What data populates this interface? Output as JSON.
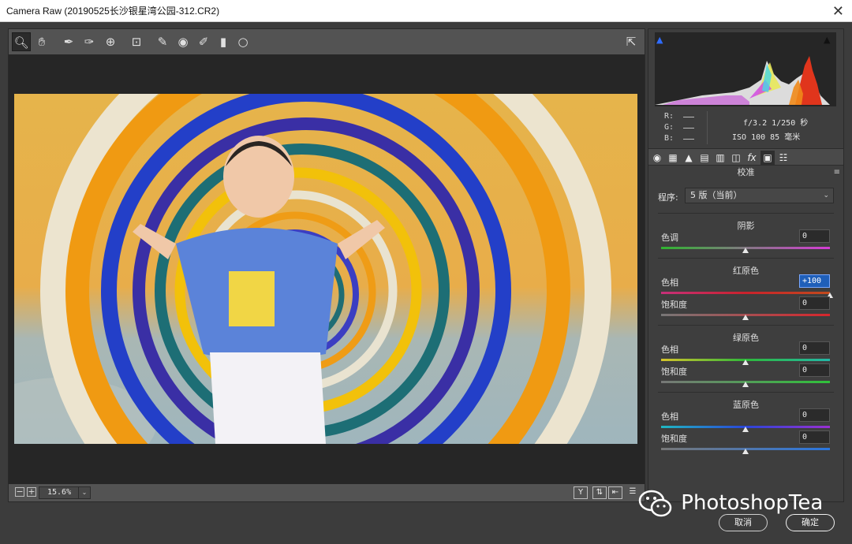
{
  "window": {
    "title": "Camera Raw (20190525长沙银星湾公园-312.CR2)"
  },
  "toolbar": {
    "tools": [
      {
        "icon": "zoom-icon",
        "glyph": "🔍︎"
      },
      {
        "icon": "hand-icon",
        "glyph": "✋︎"
      },
      {
        "icon": "white-balance-icon",
        "glyph": "✒"
      },
      {
        "icon": "color-sampler-icon",
        "glyph": "✑"
      },
      {
        "icon": "target-adjust-icon",
        "glyph": "⊕"
      },
      {
        "icon": "crop-icon",
        "glyph": "⊡"
      },
      {
        "icon": "spot-removal-icon",
        "glyph": "✎"
      },
      {
        "icon": "red-eye-icon",
        "glyph": "◉"
      },
      {
        "icon": "adjustment-brush-icon",
        "glyph": "✐"
      },
      {
        "icon": "graduated-filter-icon",
        "glyph": "▮"
      },
      {
        "icon": "radial-filter-icon",
        "glyph": "○"
      }
    ],
    "open_preferences_glyph": "⇱"
  },
  "status": {
    "zoom_out": "−",
    "zoom_in": "+",
    "zoom": "15.6%",
    "zoom_menu": "⌄",
    "view_buttons": [
      "Y",
      "⇅",
      "⇤",
      "☰"
    ]
  },
  "histogram": {
    "r": "R:",
    "g": "G:",
    "b": "B:",
    "aperture_shutter": "f/3.2  1/250 秒",
    "iso_focal": "ISO 100  85 毫米"
  },
  "panel": {
    "tabs": [
      "◉",
      "▦",
      "▲",
      "▤",
      "▥",
      "◫",
      "fx",
      "▣",
      "☷"
    ],
    "heading": "校准",
    "menu": "≡",
    "process_label": "程序:",
    "process_value": "5 版（当前）",
    "shadows": {
      "title": "阴影",
      "tint_label": "色调",
      "tint_value": "0",
      "tint": 0
    },
    "red_primary": {
      "title": "红原色",
      "hue_label": "色相",
      "hue_value": "+100",
      "hue": 100,
      "sat_label": "饱和度",
      "sat_value": "0",
      "sat": 0
    },
    "green_primary": {
      "title": "绿原色",
      "hue_label": "色相",
      "hue_value": "0",
      "hue": 0,
      "sat_label": "饱和度",
      "sat_value": "0",
      "sat": 0
    },
    "blue_primary": {
      "title": "蓝原色",
      "hue_label": "色相",
      "hue_value": "0",
      "hue": 0,
      "sat_label": "饱和度",
      "sat_value": "0",
      "sat": 0
    }
  },
  "dialog": {
    "cancel": "取消",
    "ok": "确定"
  },
  "watermark": {
    "text": "PhotoshopTea"
  }
}
